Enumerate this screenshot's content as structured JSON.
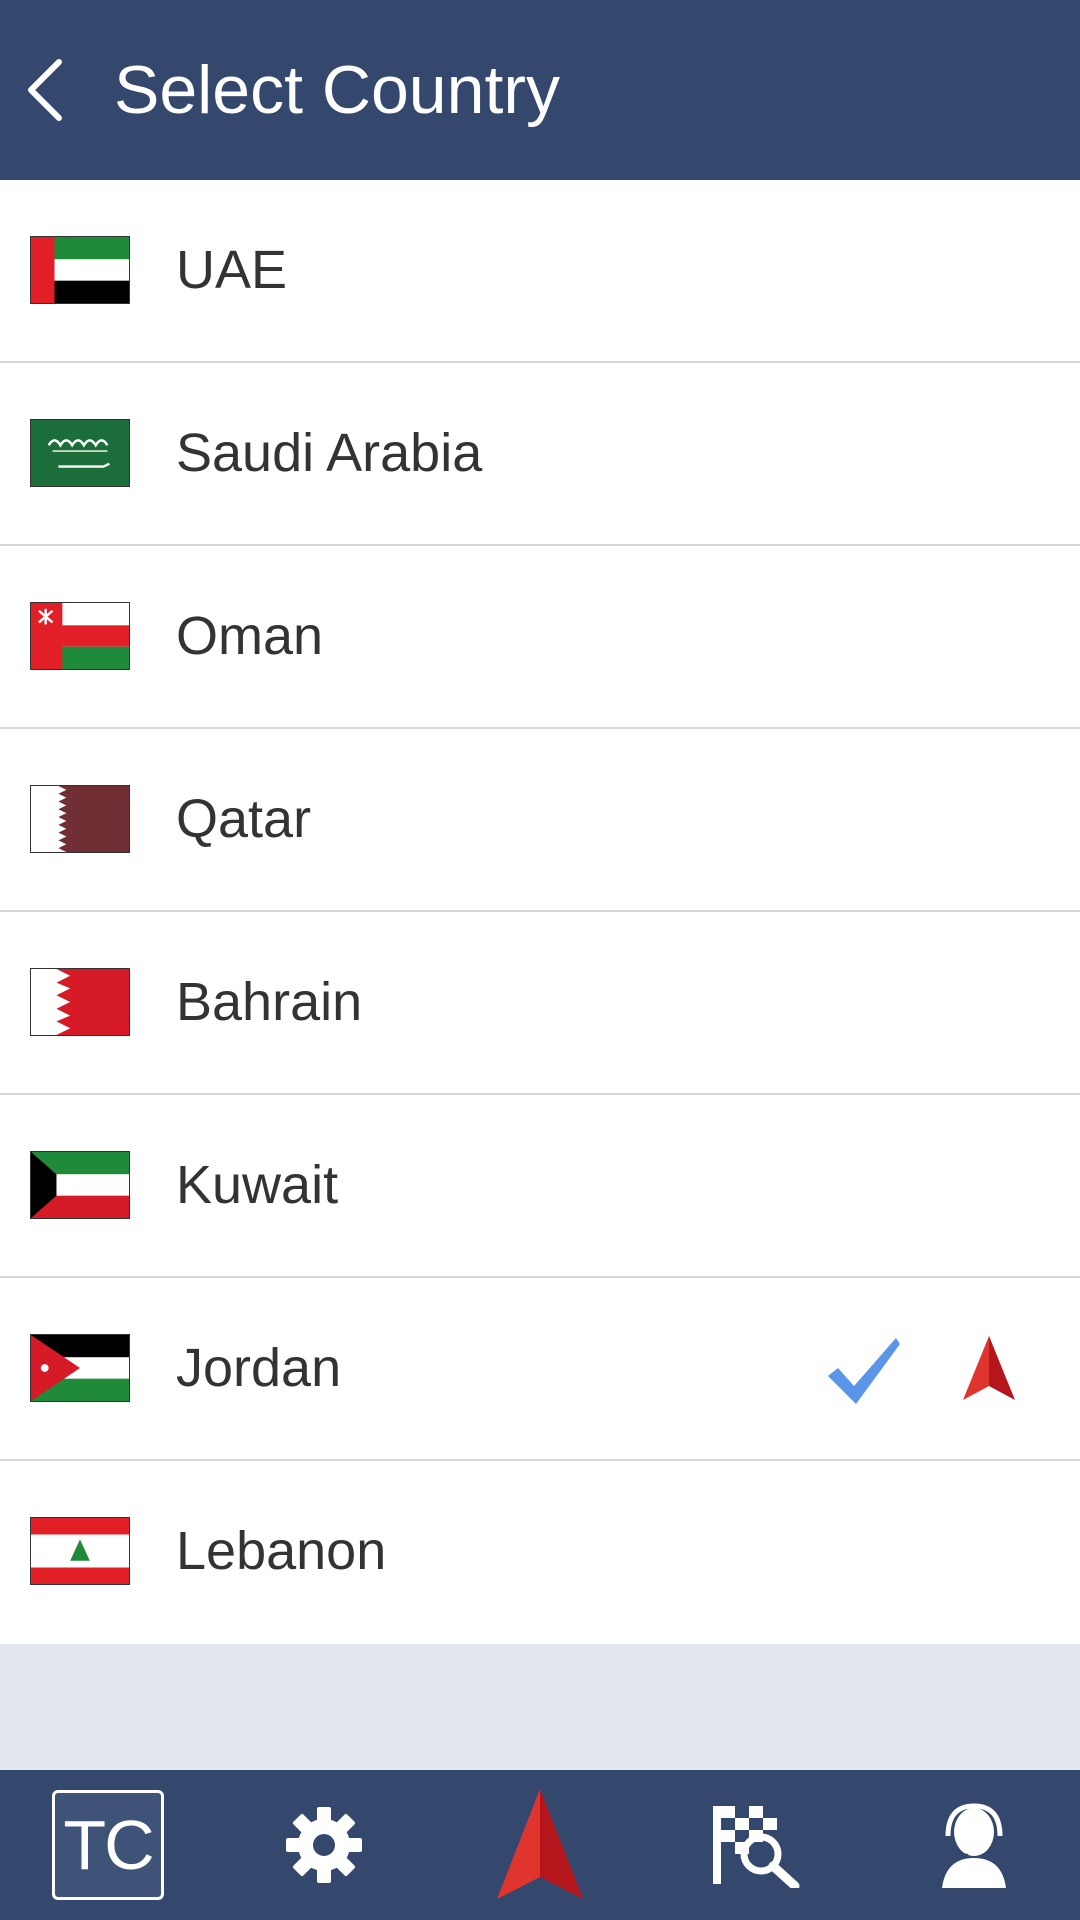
{
  "header": {
    "title": "Select Country"
  },
  "countries": [
    {
      "name": "UAE",
      "flag": "uae-flag"
    },
    {
      "name": "Saudi Arabia",
      "flag": "saudi-arabia-flag"
    },
    {
      "name": "Oman",
      "flag": "oman-flag"
    },
    {
      "name": "Qatar",
      "flag": "qatar-flag"
    },
    {
      "name": "Bahrain",
      "flag": "bahrain-flag"
    },
    {
      "name": "Kuwait",
      "flag": "kuwait-flag"
    },
    {
      "name": "Jordan",
      "flag": "jordan-flag",
      "selected": true,
      "current_location": true
    },
    {
      "name": "Lebanon",
      "flag": "lebanon-flag"
    }
  ],
  "tabbar": {
    "items": [
      {
        "label": "TC",
        "icon": "tc-logo-icon"
      },
      {
        "icon": "gear-icon"
      },
      {
        "icon": "navigation-arrow-icon"
      },
      {
        "icon": "checkered-flag-search-icon"
      },
      {
        "icon": "support-agent-icon"
      }
    ]
  },
  "colors": {
    "header_bg": "#34476d",
    "list_bg": "#ffffff",
    "empty_bg": "#e1e6ef",
    "check": "#5b95e8",
    "nav_red": "#d8262a"
  }
}
